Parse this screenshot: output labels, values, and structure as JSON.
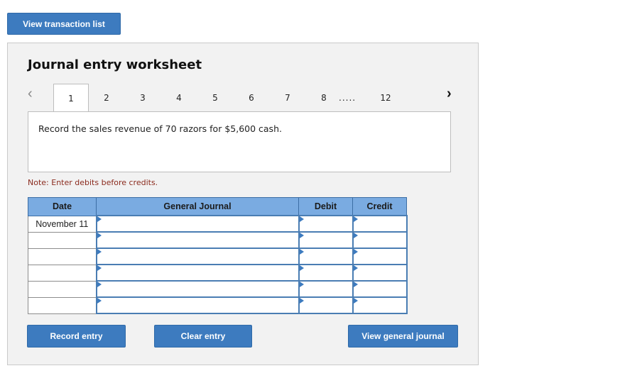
{
  "header": {
    "view_transaction_list": "View transaction list"
  },
  "worksheet": {
    "title": "Journal entry worksheet",
    "tabs": [
      "1",
      "2",
      "3",
      "4",
      "5",
      "6",
      "7",
      "8"
    ],
    "tabs_ellipsis": ".....",
    "tabs_last": "12",
    "active_tab": "1",
    "prompt": "Record the sales revenue of 70 razors for $5,600 cash.",
    "note": "Note: Enter debits before credits.",
    "table": {
      "headers": {
        "date": "Date",
        "general_journal": "General Journal",
        "debit": "Debit",
        "credit": "Credit"
      },
      "rows": [
        {
          "date": "November 11",
          "account": "",
          "debit": "",
          "credit": ""
        },
        {
          "date": "",
          "account": "",
          "debit": "",
          "credit": ""
        },
        {
          "date": "",
          "account": "",
          "debit": "",
          "credit": ""
        },
        {
          "date": "",
          "account": "",
          "debit": "",
          "credit": ""
        },
        {
          "date": "",
          "account": "",
          "debit": "",
          "credit": ""
        },
        {
          "date": "",
          "account": "",
          "debit": "",
          "credit": ""
        }
      ]
    },
    "buttons": {
      "record": "Record entry",
      "clear": "Clear entry",
      "view_journal": "View general journal"
    }
  },
  "colors": {
    "button_blue": "#3d7bbf",
    "header_blue": "#7aabe1",
    "note_red": "#8b2b1e",
    "panel_bg": "#f2f2f2"
  },
  "icons": {
    "prev": "chevron-left-icon",
    "next": "chevron-right-icon",
    "dropdown_marker": "triangle-right-icon"
  }
}
